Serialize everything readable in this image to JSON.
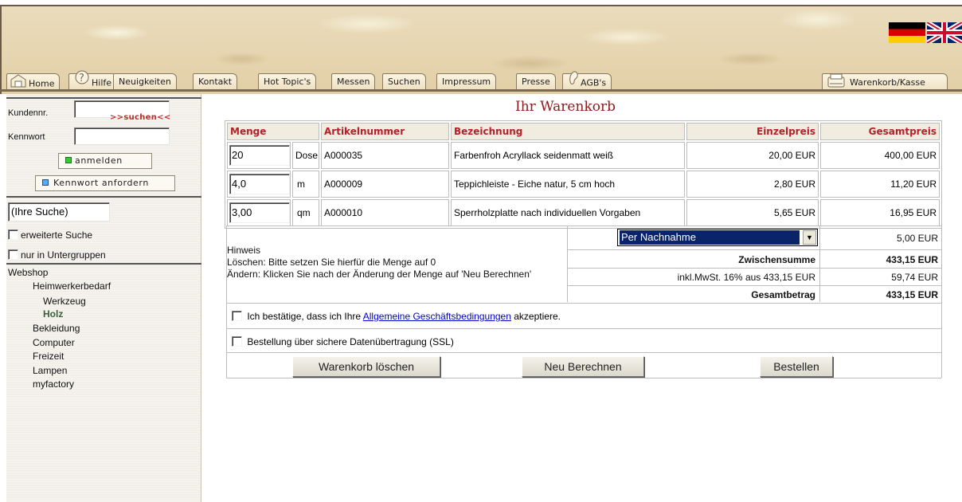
{
  "header": {
    "tabs": [
      "Home",
      "Hilfe",
      "Neuigkeiten",
      "Kontakt",
      "Hot Topic's",
      "Messen",
      "Suchen",
      "Impressum",
      "Presse",
      "AGB's"
    ],
    "cart_tab": "Warenkorb/Kasse"
  },
  "sidebar": {
    "kundennr_label": "Kundennr.",
    "kundennr_value": "",
    "kennwort_label": "Kennwort",
    "kennwort_value": "",
    "login_button": "anmelden",
    "pw_button": "Kennwort anfordern",
    "search_value": "(Ihre Suche)",
    "search_button": ">>suchen<<",
    "extended_search": "erweiterte Suche",
    "subgroups": "nur in Untergruppen",
    "tree": {
      "root": "Webshop",
      "cat1": "Heimwerkerbedarf",
      "sub1": "Werkzeug",
      "sub2": "Holz",
      "cat2": "Bekleidung",
      "cat3": "Computer",
      "cat4": "Freizeit",
      "cat5": "Lampen",
      "cat6": "myfactory"
    }
  },
  "main": {
    "title": "Ihr Warenkorb",
    "columns": {
      "qty": "Menge",
      "article": "Artikelnummer",
      "name": "Bezeichnung",
      "unit_price": "Einzelpreis",
      "total_price": "Gesamtpreis"
    },
    "rows": [
      {
        "qty": "20",
        "unit": "Dose",
        "article": "A000035",
        "name": "Farbenfroh Acryllack seidenmatt weiß",
        "unit_price": "20,00 EUR",
        "total": "400,00 EUR"
      },
      {
        "qty": "4,0",
        "unit": "m",
        "article": "A000009",
        "name": "Teppichleiste - Eiche natur, 5 cm hoch",
        "unit_price": "2,80 EUR",
        "total": "11,20 EUR"
      },
      {
        "qty": "3,00",
        "unit": "qm",
        "article": "A000010",
        "name": "Sperrholzplatte nach individuellen Vorgaben",
        "unit_price": "5,65 EUR",
        "total": "16,95 EUR"
      }
    ],
    "hinweis": {
      "title": "Hinweis",
      "line1": "Löschen: Bitte setzen Sie hierfür die Menge auf 0",
      "line2": "Ändern: Klicken Sie nach der Änderung der Menge auf 'Neu Berechnen'"
    },
    "payment": {
      "selected": "Per Nachnahme",
      "fee": "5,00 EUR"
    },
    "subtotal": {
      "label": "Zwischensumme",
      "value": "433,15 EUR"
    },
    "vat": {
      "label": "inkl.MwSt. 16% aus 433,15 EUR",
      "value": "59,74 EUR"
    },
    "grand_total": {
      "label": "Gesamtbetrag",
      "value": "433,15 EUR"
    },
    "agb": {
      "pre": "Ich bestätige, dass ich Ihre",
      "link": "Allgemeine Geschäftsbedingungen",
      "post": "akzeptiere."
    },
    "ssl": "Bestellung über sichere Datenübertragung (SSL)",
    "buttons": {
      "clear": "Warenkorb löschen",
      "recalc": "Neu Berechnen",
      "order": "Bestellen"
    }
  }
}
